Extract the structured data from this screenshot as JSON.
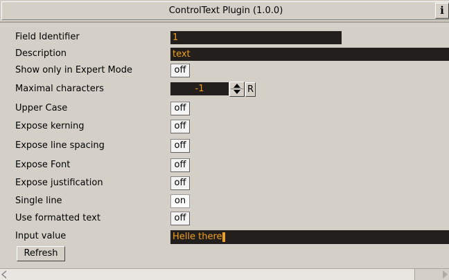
{
  "window": {
    "title": "ControlText Plugin (1.0.0)",
    "info_label": "i"
  },
  "fields": {
    "field_identifier": {
      "label": "Field Identifier",
      "value": "1"
    },
    "description": {
      "label": "Description",
      "value": "text"
    },
    "expert_mode": {
      "label": "Show only in Expert Mode",
      "value": "off"
    },
    "max_chars": {
      "label": "Maximal characters",
      "value": "-1",
      "reset_label": "R"
    },
    "upper_case": {
      "label": "Upper Case",
      "value": "off"
    },
    "expose_kerning": {
      "label": "Expose kerning",
      "value": "off"
    },
    "expose_line_spacing": {
      "label": "Expose line spacing",
      "value": "off"
    },
    "expose_font": {
      "label": "Expose Font",
      "value": "off"
    },
    "expose_justification": {
      "label": "Expose justification",
      "value": "off"
    },
    "single_line": {
      "label": "Single line",
      "value": "on"
    },
    "formatted_text": {
      "label": "Use formatted text",
      "value": "off"
    },
    "input_value": {
      "label": "Input value",
      "value": "Helle there"
    }
  },
  "buttons": {
    "refresh": "Refresh"
  },
  "colors": {
    "field_bg": "#231f1c",
    "field_text": "#f0a01e",
    "panel_bg": "#d4d0c8"
  }
}
